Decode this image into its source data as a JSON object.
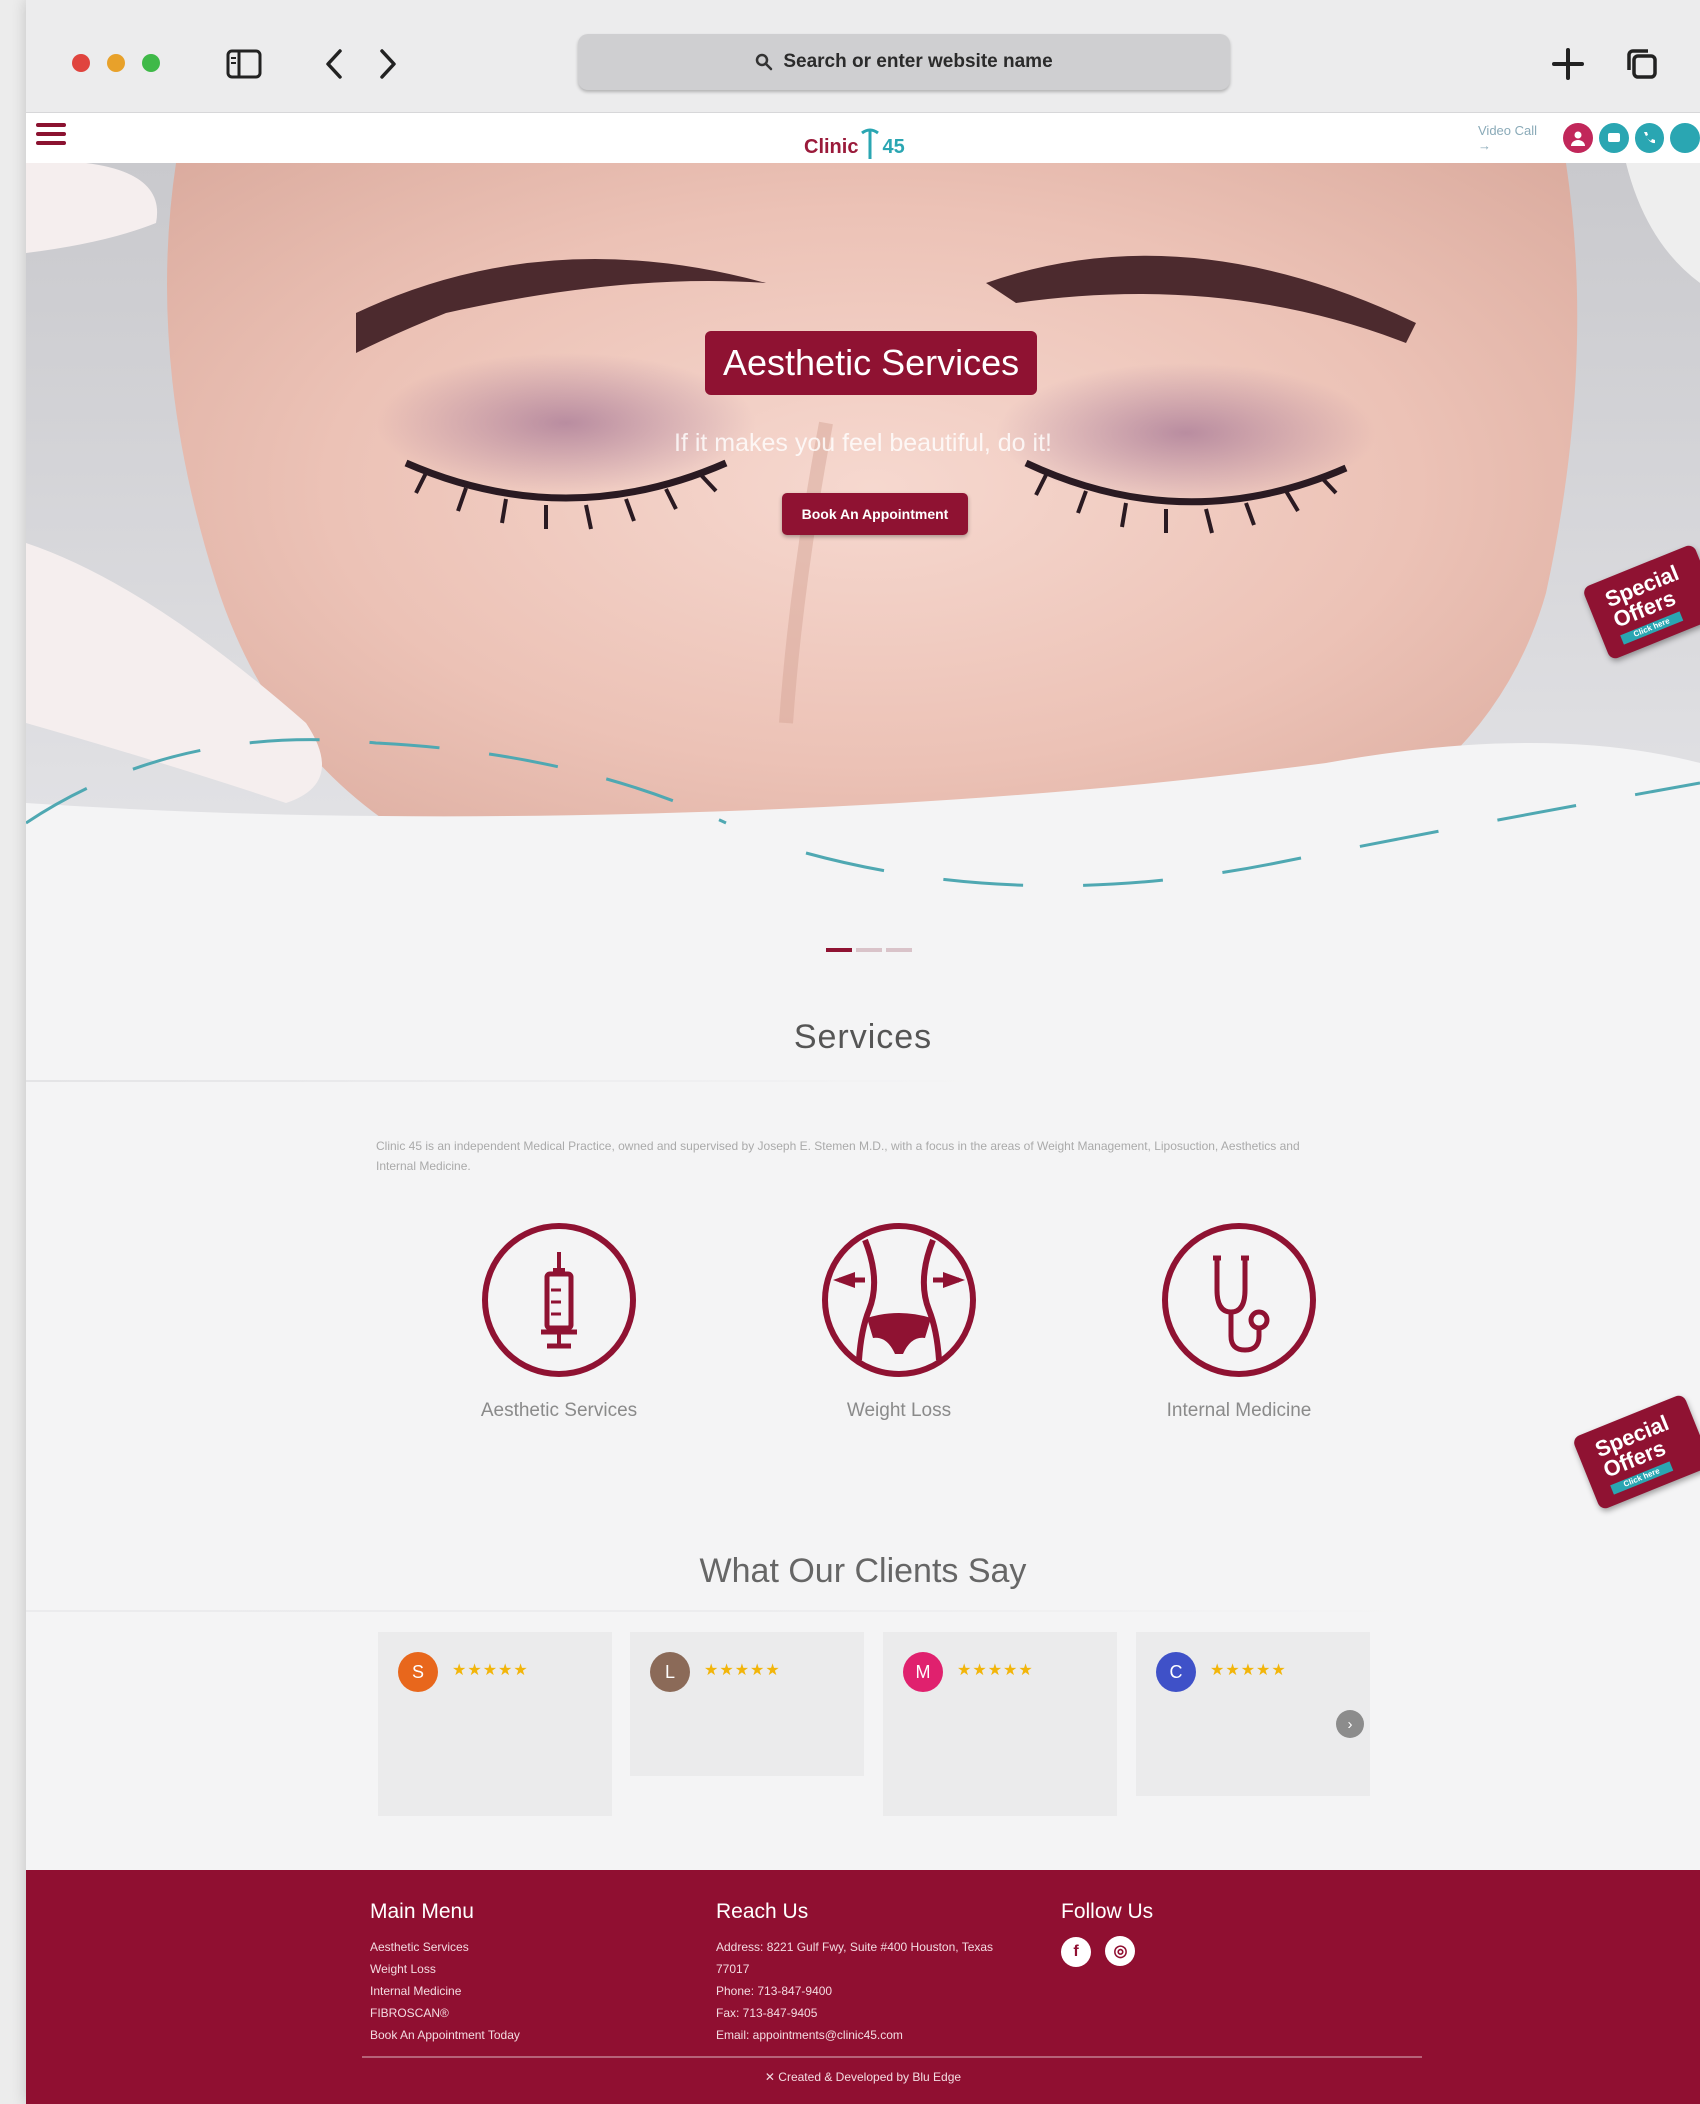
{
  "browser": {
    "address_placeholder": "Search or enter website name"
  },
  "site": {
    "logo_text": "Clinic",
    "logo_number": "45",
    "video_call_label": "Video Call →"
  },
  "hero": {
    "title": "Aesthetic Services",
    "tagline": "If it makes you feel beautiful, do it!",
    "cta_label": "Book An Appointment"
  },
  "special_offer": {
    "line1": "Special",
    "line2": "Offers",
    "sub": "Click here"
  },
  "services": {
    "title": "Services",
    "description": "Clinic 45 is an independent Medical Practice, owned and supervised by Joseph E. Stemen M.D., with a focus in the areas of Weight Management, Liposuction, Aesthetics and Internal Medicine.",
    "items": [
      {
        "label": "Aesthetic Services",
        "icon": "syringe-icon"
      },
      {
        "label": "Weight Loss",
        "icon": "waist-icon"
      },
      {
        "label": "Internal Medicine",
        "icon": "stethoscope-icon"
      }
    ]
  },
  "testimonials": {
    "title": "What Our Clients Say",
    "reviews": [
      {
        "initial": "S",
        "stars": "★★★★★",
        "color": "#e8671c"
      },
      {
        "initial": "L",
        "stars": "★★★★★",
        "color": "#8b6a58"
      },
      {
        "initial": "M",
        "stars": "★★★★★",
        "color": "#e0216e"
      },
      {
        "initial": "C",
        "stars": "★★★★★",
        "color": "#3f51c8"
      }
    ],
    "next_label": "›"
  },
  "footer": {
    "menu_title": "Main Menu",
    "menu_items": [
      "Aesthetic Services",
      "Weight Loss",
      "Internal Medicine",
      "FIBROSCAN®",
      "Book An Appointment Today"
    ],
    "reach_title": "Reach Us",
    "address": "Address: 8221 Gulf Fwy, Suite #400 Houston, Texas",
    "zip": "77017",
    "phone": "Phone: 713-847-9400",
    "fax": "Fax: 713-847-9405",
    "email": "Email: appointments@clinic45.com",
    "follow_title": "Follow Us",
    "social": [
      "f",
      "◎"
    ],
    "credit": "Created & Developed by Blu Edge"
  },
  "colors": {
    "brand": "#8f1232",
    "accent": "#2aa6b2",
    "footer": "#900f31"
  }
}
